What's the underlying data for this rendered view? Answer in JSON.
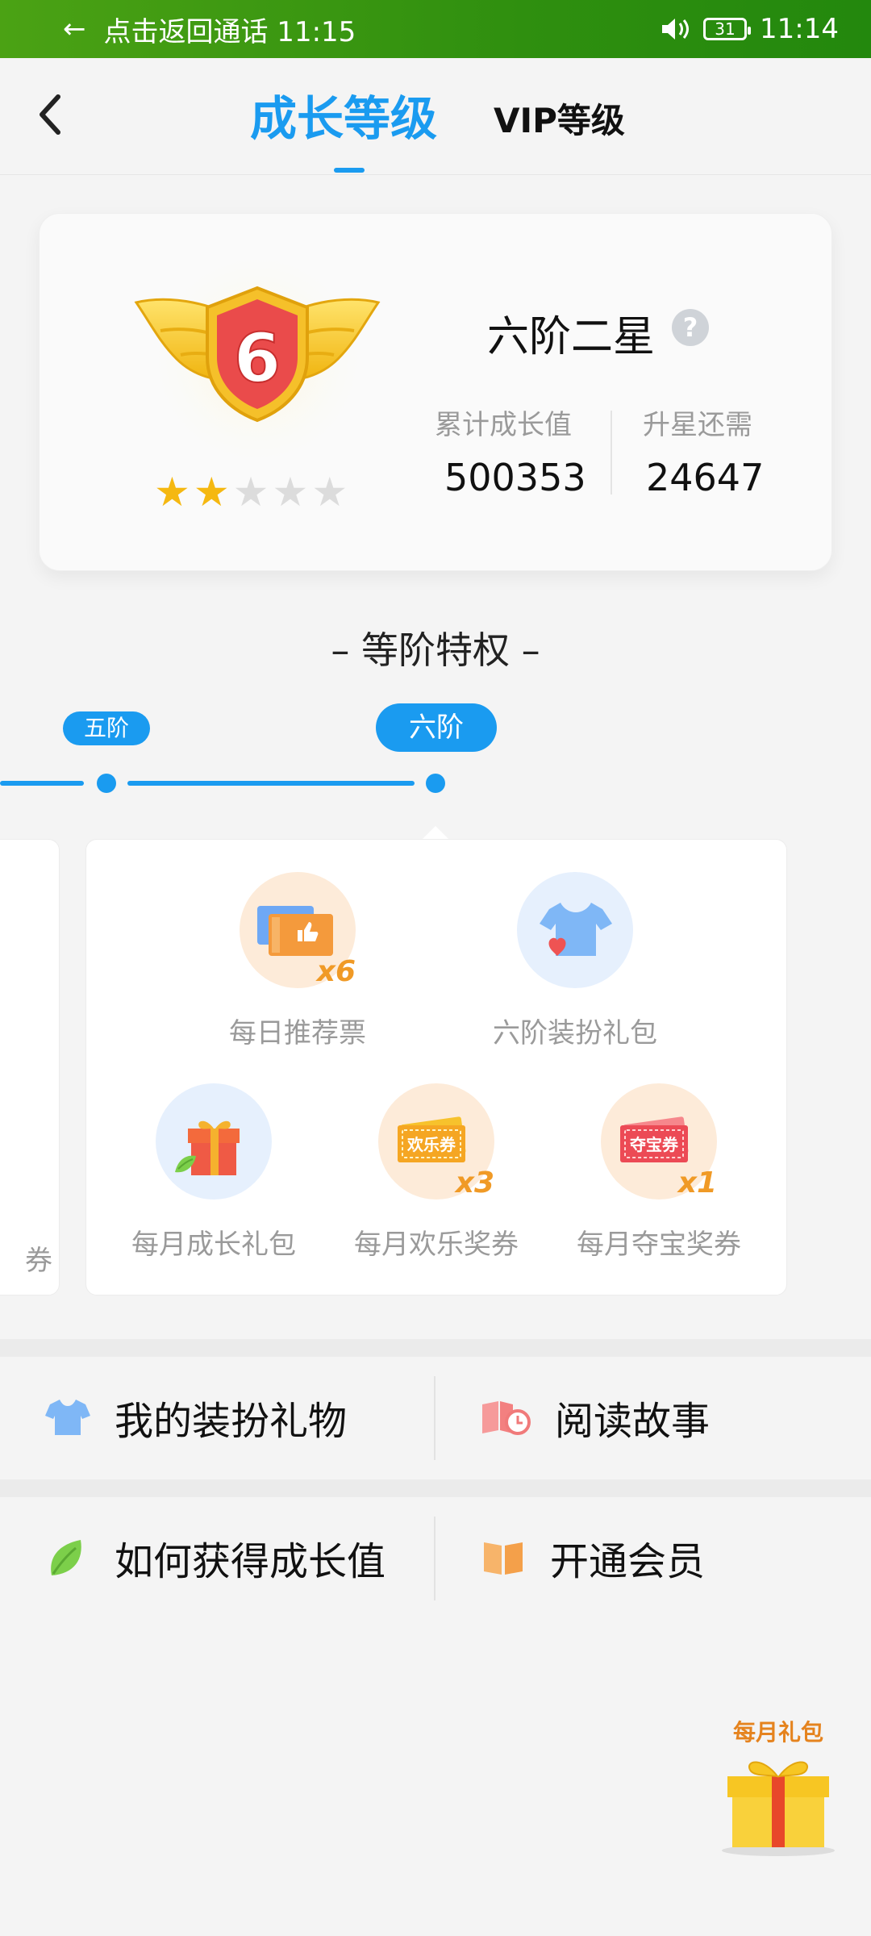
{
  "status_bar": {
    "call_return": "点击返回通话 11:15",
    "battery": "31",
    "time": "11:14"
  },
  "header": {
    "tab_growth": "成长等级",
    "tab_vip": "VIP等级"
  },
  "level": {
    "badge_number": "6",
    "stars_filled": 2,
    "stars_total": 5,
    "name": "六阶二星",
    "cumulative_label": "累计成长值",
    "cumulative_value": "500353",
    "upgrade_label": "升星还需",
    "upgrade_value": "24647"
  },
  "privileges": {
    "title": "– 等阶特权 –",
    "tiers": [
      "五阶",
      "六阶"
    ],
    "side_cut_text": "券",
    "items": [
      {
        "label": "每日推荐票",
        "multiplier": "x6",
        "icon": "ticket-icon"
      },
      {
        "label": "六阶装扮礼包",
        "multiplier": "",
        "icon": "shirt-icon"
      },
      {
        "label": "每月成长礼包",
        "multiplier": "",
        "icon": "gift-icon"
      },
      {
        "label": "每月欢乐奖券",
        "multiplier": "x3",
        "icon": "coupon-icon",
        "coupon_text": "欢乐券"
      },
      {
        "label": "每月夺宝奖券",
        "multiplier": "x1",
        "icon": "coupon-icon",
        "coupon_text": "夺宝券"
      }
    ]
  },
  "menu": {
    "my_outfits": "我的装扮礼物",
    "read_stories": "阅读故事",
    "how_to_get": "如何获得成长值",
    "open_member": "开通会员"
  },
  "float_gift": {
    "label": "每月礼包"
  },
  "colors": {
    "accent": "#1a9bf0",
    "status_bar": "#2f8f0f",
    "star": "#f5b811",
    "multiplier": "#f09a26"
  }
}
